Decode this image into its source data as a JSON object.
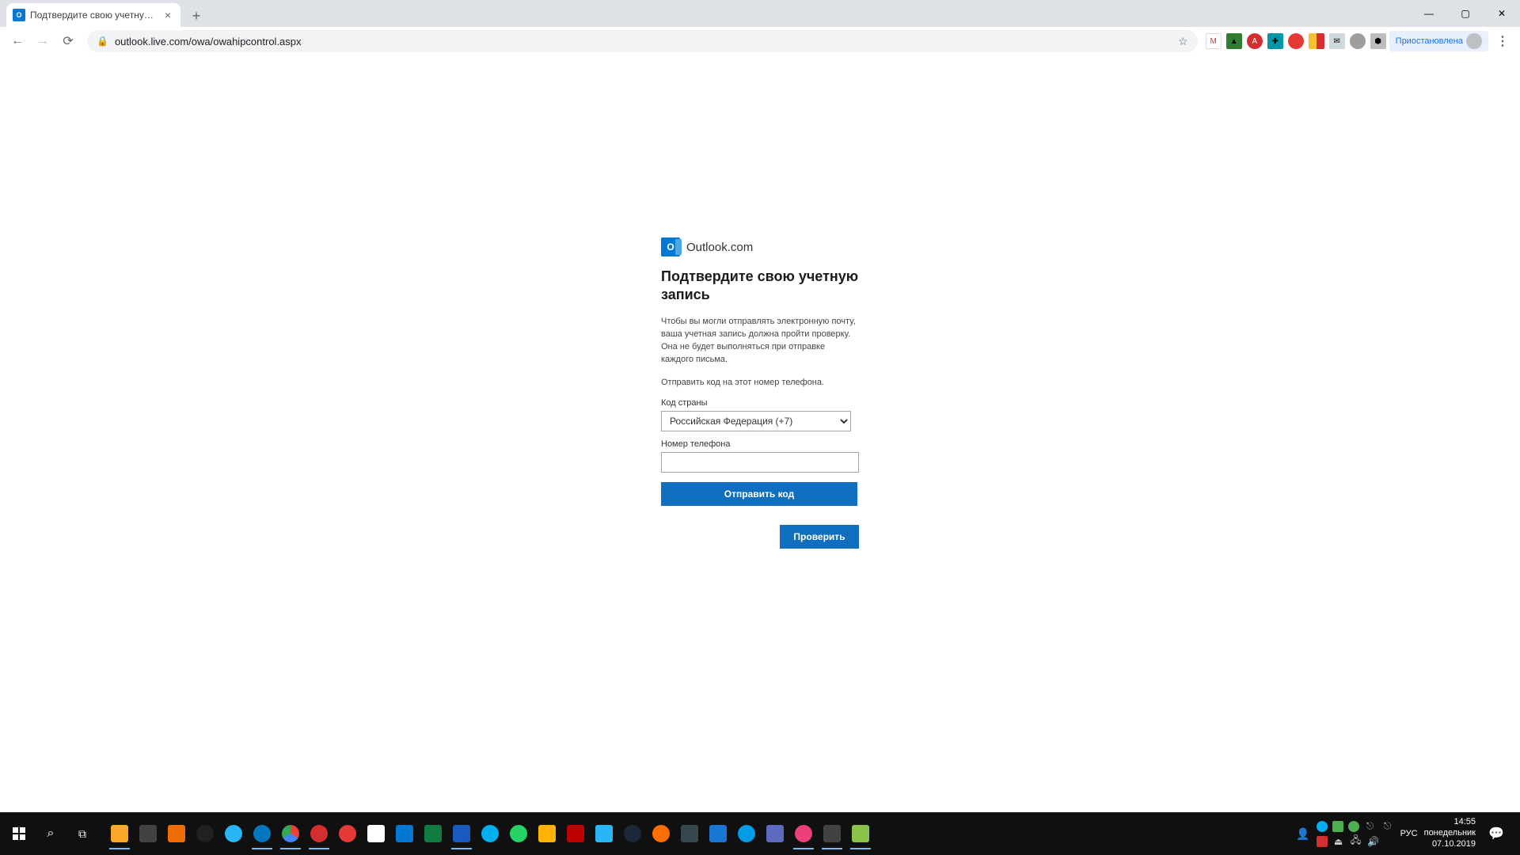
{
  "browser": {
    "tab_title": "Подтвердите свою учетную за",
    "url": "outlook.live.com/owa/owahipcontrol.aspx",
    "sync_status": "Приостановлена"
  },
  "page": {
    "brand": "Outlook.com",
    "heading": "Подтвердите свою учетную запись",
    "body": "Чтобы вы могли отправлять электронную почту, ваша учетная запись должна пройти проверку. Она не будет выполняться при отправке каждого письма.",
    "instruction": "Отправить код на этот номер телефона.",
    "country_label": "Код страны",
    "country_selected": "Российская Федерация (+7)",
    "phone_label": "Номер телефона",
    "send_button": "Отправить код",
    "verify_button": "Проверить"
  },
  "taskbar": {
    "language": "РУС",
    "time": "14:55",
    "day": "понедельник",
    "date": "07.10.2019"
  }
}
